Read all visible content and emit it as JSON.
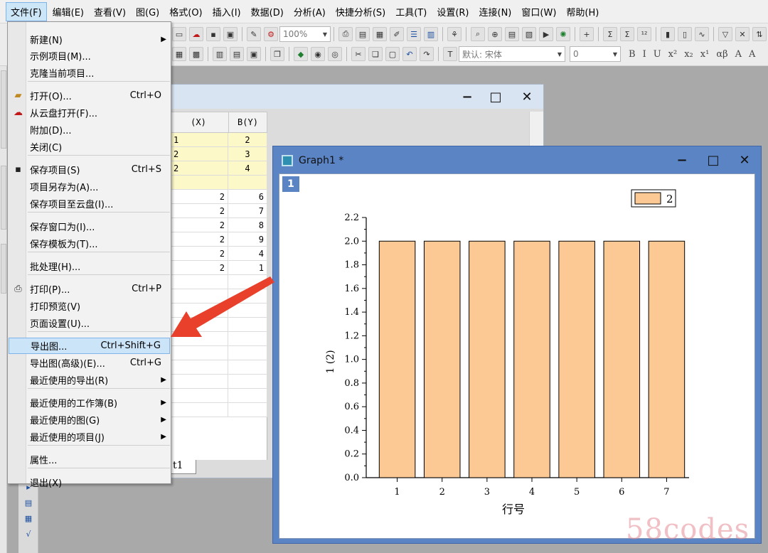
{
  "menubar": {
    "items": [
      "文件(F)",
      "编辑(E)",
      "查看(V)",
      "图(G)",
      "格式(O)",
      "插入(I)",
      "数据(D)",
      "分析(A)",
      "快捷分析(S)",
      "工具(T)",
      "设置(R)",
      "连接(N)",
      "窗口(W)",
      "帮助(H)"
    ]
  },
  "toolbar": {
    "zoom": "100%",
    "font_name": "默认: 宋体",
    "font_size": "0",
    "format_buttons": [
      "B",
      "I",
      "U",
      "x²",
      "x₂",
      "x¹",
      "αβ",
      "A",
      "A"
    ]
  },
  "file_menu": {
    "items": [
      {
        "label": "新建(N)",
        "shortcut": "",
        "submenu": true,
        "icon": ""
      },
      {
        "label": "示例项目(M)...",
        "shortcut": "",
        "submenu": false,
        "icon": ""
      },
      {
        "label": "克隆当前项目...",
        "shortcut": "",
        "submenu": false,
        "icon": ""
      },
      {
        "label": "打开(O)...",
        "shortcut": "Ctrl+O",
        "submenu": false,
        "icon": "folder-open-icon"
      },
      {
        "label": "从云盘打开(F)...",
        "shortcut": "",
        "submenu": false,
        "icon": "cloud-download-icon"
      },
      {
        "label": "附加(D)...",
        "shortcut": "",
        "submenu": false,
        "icon": ""
      },
      {
        "label": "关闭(C)",
        "shortcut": "",
        "submenu": false,
        "icon": ""
      },
      {
        "label": "保存项目(S)",
        "shortcut": "Ctrl+S",
        "submenu": false,
        "icon": "save-icon"
      },
      {
        "label": "项目另存为(A)...",
        "shortcut": "",
        "submenu": false,
        "icon": ""
      },
      {
        "label": "保存项目至云盘(I)...",
        "shortcut": "",
        "submenu": false,
        "icon": ""
      },
      {
        "label": "保存窗口为(I)...",
        "shortcut": "",
        "submenu": false,
        "icon": ""
      },
      {
        "label": "保存模板为(T)...",
        "shortcut": "",
        "submenu": false,
        "icon": ""
      },
      {
        "label": "批处理(H)...",
        "shortcut": "",
        "submenu": false,
        "icon": ""
      },
      {
        "label": "打印(P)...",
        "shortcut": "Ctrl+P",
        "submenu": false,
        "icon": "printer-icon"
      },
      {
        "label": "打印预览(V)",
        "shortcut": "",
        "submenu": false,
        "icon": ""
      },
      {
        "label": "页面设置(U)...",
        "shortcut": "",
        "submenu": false,
        "icon": ""
      },
      {
        "label": "导出图...",
        "shortcut": "Ctrl+Shift+G",
        "submenu": false,
        "icon": "",
        "highlighted": true
      },
      {
        "label": "导出图(高级)(E)...",
        "shortcut": "Ctrl+G",
        "submenu": false,
        "icon": ""
      },
      {
        "label": "最近使用的导出(R)",
        "shortcut": "",
        "submenu": true,
        "icon": ""
      },
      {
        "label": "最近使用的工作簿(B)",
        "shortcut": "",
        "submenu": true,
        "icon": ""
      },
      {
        "label": "最近使用的图(G)",
        "shortcut": "",
        "submenu": true,
        "icon": ""
      },
      {
        "label": "最近使用的项目(J)",
        "shortcut": "",
        "submenu": true,
        "icon": ""
      },
      {
        "label": "属性...",
        "shortcut": "",
        "submenu": false,
        "icon": ""
      },
      {
        "label": "退出(X)",
        "shortcut": "",
        "submenu": false,
        "icon": ""
      }
    ]
  },
  "workbook": {
    "col_a_header": "(X)",
    "col_b_header": "B(Y)",
    "rows": [
      {
        "a": "1",
        "b": "2",
        "meta": true
      },
      {
        "a": "2",
        "b": "3",
        "meta": true
      },
      {
        "a": "2",
        "b": "4",
        "meta": true
      },
      {
        "a": "",
        "b": "",
        "meta": true
      },
      {
        "a": "2",
        "b": "6",
        "meta": false
      },
      {
        "a": "2",
        "b": "7",
        "meta": false
      },
      {
        "a": "2",
        "b": "8",
        "meta": false
      },
      {
        "a": "2",
        "b": "9",
        "meta": false
      },
      {
        "a": "2",
        "b": "4",
        "meta": false
      },
      {
        "a": "2",
        "b": "1",
        "meta": false
      }
    ],
    "sheet_tab": "t1"
  },
  "graph_window": {
    "title": "Graph1 *",
    "layer": "1"
  },
  "chart_data": {
    "type": "bar",
    "categories": [
      "1",
      "2",
      "3",
      "4",
      "5",
      "6",
      "7"
    ],
    "series": [
      {
        "name": "2",
        "values": [
          2,
          2,
          2,
          2,
          2,
          2,
          2
        ],
        "color": "#fcc994"
      }
    ],
    "xlabel": "行号",
    "ylabel": "1 (2)",
    "ylim": [
      0,
      2.2
    ],
    "yticks": [
      "0.0",
      "0.2",
      "0.4",
      "0.6",
      "0.8",
      "1.0",
      "1.2",
      "1.4",
      "1.6",
      "1.8",
      "2.0",
      "2.2"
    ],
    "legend": "top-right",
    "grid": false
  },
  "colors": {
    "annotation_arrow": "#e8402a",
    "bar_fill": "#fcc994"
  },
  "watermark": "58codes"
}
